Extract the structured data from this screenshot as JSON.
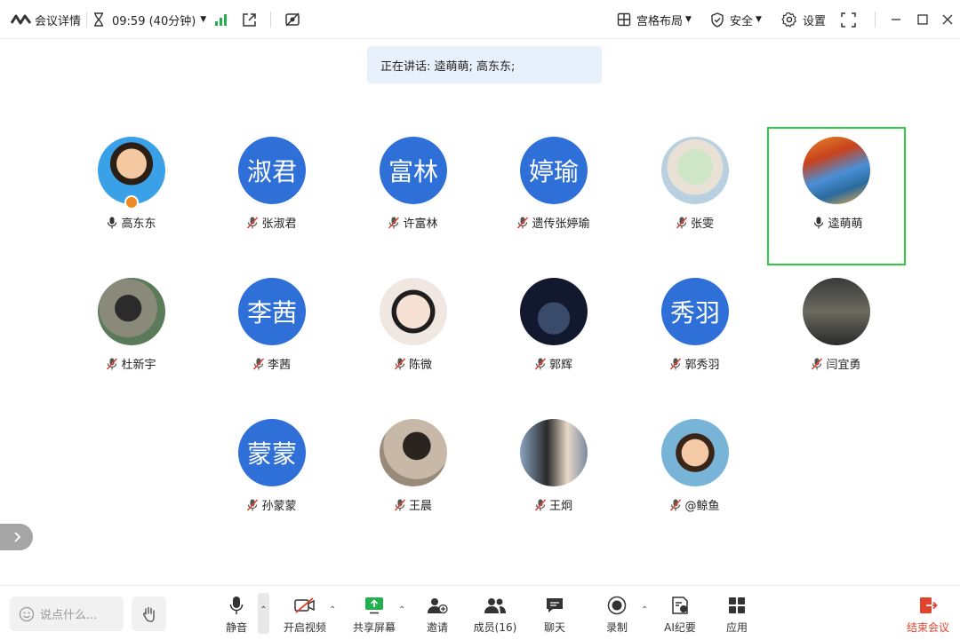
{
  "topbar": {
    "meeting_details": "会议详情",
    "timer": "09:59 (40分钟)",
    "layout": "宫格布局",
    "security": "安全",
    "settings": "设置"
  },
  "speaking": {
    "text": "正在讲话: 逵萌萌; 高东东;"
  },
  "participants": [
    {
      "name": "高东东",
      "avatar_text": "",
      "mic": "on"
    },
    {
      "name": "张淑君",
      "avatar_text": "淑君",
      "mic": "muted"
    },
    {
      "name": "许富林",
      "avatar_text": "富林",
      "mic": "muted"
    },
    {
      "name": "遗传张婷瑜",
      "avatar_text": "婷瑜",
      "mic": "muted"
    },
    {
      "name": "张雯",
      "avatar_text": "",
      "mic": "muted"
    },
    {
      "name": "逵萌萌",
      "avatar_text": "",
      "mic": "on",
      "active": true
    },
    {
      "name": "杜新宇",
      "avatar_text": "",
      "mic": "muted"
    },
    {
      "name": "李茜",
      "avatar_text": "李茜",
      "mic": "muted"
    },
    {
      "name": "陈微",
      "avatar_text": "",
      "mic": "muted"
    },
    {
      "name": "郭辉",
      "avatar_text": "",
      "mic": "muted"
    },
    {
      "name": "郭秀羽",
      "avatar_text": "秀羽",
      "mic": "muted"
    },
    {
      "name": "闫宜勇",
      "avatar_text": "",
      "mic": "muted"
    },
    {
      "name": "孙蒙蒙",
      "avatar_text": "蒙蒙",
      "mic": "muted"
    },
    {
      "name": "王晨",
      "avatar_text": "",
      "mic": "muted"
    },
    {
      "name": "王炯",
      "avatar_text": "",
      "mic": "muted"
    },
    {
      "name": "@鲸鱼",
      "avatar_text": "",
      "mic": "muted"
    }
  ],
  "bottombar": {
    "chat_placeholder": "说点什么...",
    "mute": "静音",
    "video": "开启视频",
    "share": "共享屏幕",
    "invite": "邀请",
    "members": "成员(16)",
    "chat": "聊天",
    "record": "录制",
    "ai": "AI纪要",
    "apps": "应用",
    "end": "结束会议"
  },
  "colors": {
    "accent": "#2f6fd8",
    "active_border": "#2ecc40",
    "end_red": "#e2432c",
    "signal_green": "#22b14c"
  }
}
